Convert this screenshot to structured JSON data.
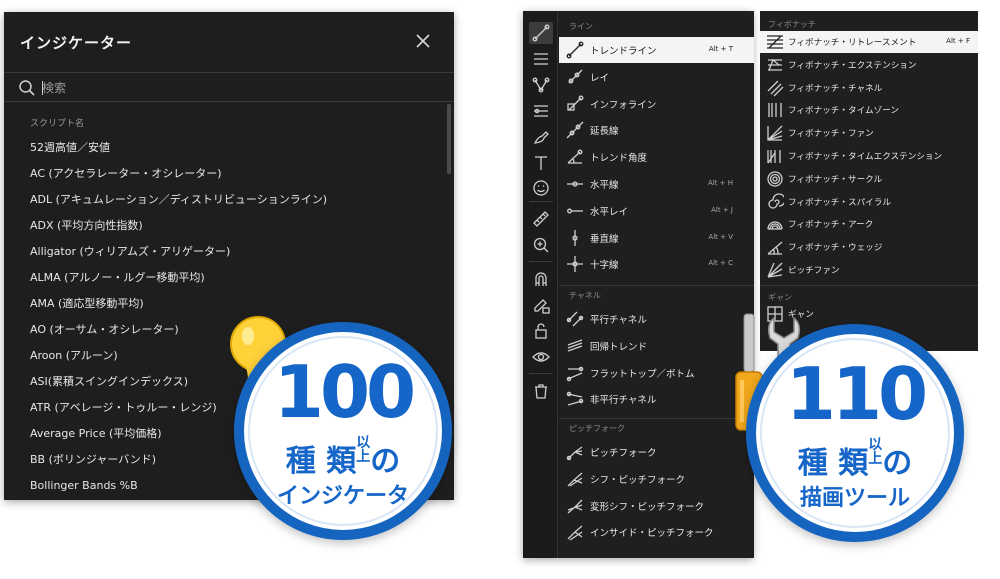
{
  "indicators": {
    "title": "インジケーター",
    "search_placeholder": "検索",
    "section_label": "スクリプト名",
    "items": [
      "52週高値／安値",
      "AC (アクセラレーター・オシレーター)",
      "ADL (アキュムレーション／ディストリビューションライン)",
      "ADX (平均方向性指数)",
      "Alligator (ウィリアムズ・アリゲーター)",
      "ALMA (アルノー・ルグー移動平均)",
      "AMA (適応型移動平均)",
      "AO (オーサム・オシレーター)",
      "Aroon (アルーン)",
      "ASI(累積スイングインデックス)",
      "ATR (アベレージ・トゥルー・レンジ)",
      "Average Price (平均価格)",
      "BB (ボリンジャーバンド)",
      "Bollinger Bands %B"
    ]
  },
  "toolbar": {
    "icons": [
      "trendline-icon",
      "lines-icon",
      "pattern-icon",
      "fib-icon",
      "brush-icon",
      "text-icon",
      "emoji-icon",
      "ruler-icon",
      "zoom-in-icon",
      "magnet-icon",
      "lock-pencil-icon",
      "lock-icon",
      "eye-icon",
      "trash-icon"
    ]
  },
  "drawing_menu": {
    "sections": [
      {
        "label": "ライン",
        "items": [
          {
            "label": "トレンドライン",
            "shortcut": "Alt + T",
            "highlighted": true,
            "icon": "trendline-icon"
          },
          {
            "label": "レイ",
            "shortcut": "",
            "icon": "ray-icon"
          },
          {
            "label": "インフォライン",
            "shortcut": "",
            "icon": "info-line-icon"
          },
          {
            "label": "延長線",
            "shortcut": "",
            "icon": "extended-line-icon"
          },
          {
            "label": "トレンド角度",
            "shortcut": "",
            "icon": "trend-angle-icon"
          },
          {
            "label": "水平線",
            "shortcut": "Alt + H",
            "icon": "horizontal-line-icon"
          },
          {
            "label": "水平レイ",
            "shortcut": "Alt + J",
            "icon": "horizontal-ray-icon"
          },
          {
            "label": "垂直線",
            "shortcut": "Alt + V",
            "icon": "vertical-line-icon"
          },
          {
            "label": "十字線",
            "shortcut": "Alt + C",
            "icon": "cross-line-icon"
          }
        ]
      },
      {
        "label": "チャネル",
        "items": [
          {
            "label": "平行チャネル",
            "shortcut": "",
            "icon": "parallel-channel-icon"
          },
          {
            "label": "回帰トレンド",
            "shortcut": "",
            "icon": "regression-trend-icon"
          },
          {
            "label": "フラットトップ／ボトム",
            "shortcut": "",
            "icon": "flat-top-bottom-icon"
          },
          {
            "label": "非平行チャネル",
            "shortcut": "",
            "icon": "disjoint-channel-icon"
          }
        ]
      },
      {
        "label": "ピッチフォーク",
        "items": [
          {
            "label": "ピッチフォーク",
            "shortcut": "",
            "icon": "pitchfork-icon"
          },
          {
            "label": "シフ・ピッチフォーク",
            "shortcut": "",
            "icon": "schiff-pitchfork-icon"
          },
          {
            "label": "変形シフ・ピッチフォーク",
            "shortcut": "",
            "icon": "modified-schiff-icon"
          },
          {
            "label": "インサイド・ピッチフォーク",
            "shortcut": "",
            "icon": "inside-pitchfork-icon"
          }
        ]
      }
    ]
  },
  "fib_menu": {
    "section_label": "フィボナッチ",
    "items": [
      {
        "label": "フィボナッチ・リトレースメント",
        "shortcut": "Alt + F",
        "highlighted": true,
        "icon": "fib-retracement-icon"
      },
      {
        "label": "フィボナッチ・エクステンション",
        "shortcut": "",
        "icon": "fib-extension-icon"
      },
      {
        "label": "フィボナッチ・チャネル",
        "shortcut": "",
        "icon": "fib-channel-icon"
      },
      {
        "label": "フィボナッチ・タイムゾーン",
        "shortcut": "",
        "icon": "fib-timezone-icon"
      },
      {
        "label": "フィボナッチ・ファン",
        "shortcut": "",
        "icon": "fib-fan-icon"
      },
      {
        "label": "フィボナッチ・タイムエクステンション",
        "shortcut": "",
        "icon": "fib-time-extension-icon"
      },
      {
        "label": "フィボナッチ・サークル",
        "shortcut": "",
        "icon": "fib-circle-icon"
      },
      {
        "label": "フィボナッチ・スパイラル",
        "shortcut": "",
        "icon": "fib-spiral-icon"
      },
      {
        "label": "フィボナッチ・アーク",
        "shortcut": "",
        "icon": "fib-arc-icon"
      },
      {
        "label": "フィボナッチ・ウェッジ",
        "shortcut": "",
        "icon": "fib-wedge-icon"
      },
      {
        "label": "ピッチファン",
        "shortcut": "",
        "icon": "pitchfan-icon"
      }
    ],
    "section2_label": "ギャン",
    "partial_item": "ギャン"
  },
  "badge_left": {
    "number": "100",
    "line1_big": "種 類",
    "line1_small_top": "以",
    "line1_small_bottom": "上",
    "line1_tail": "の",
    "line2": "インジケータ"
  },
  "badge_right": {
    "number": "110",
    "line1_big": "種 類",
    "line1_small_top": "以",
    "line1_small_bottom": "上",
    "line1_tail": "の",
    "line2": "描画ツール"
  },
  "colors": {
    "panel_bg": "#1e1e1e",
    "highlight": "#f4f4f4",
    "badge_blue": "#1566c8",
    "bulb_yellow": "#ffd23a"
  }
}
